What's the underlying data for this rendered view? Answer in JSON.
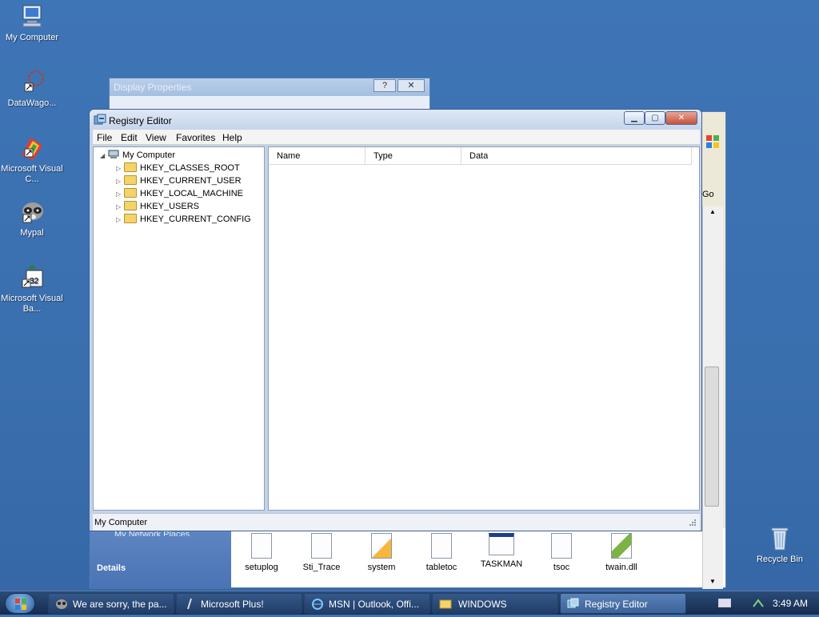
{
  "desktop": {
    "icons": [
      {
        "label": "My Computer"
      },
      {
        "label": "DataWago..."
      },
      {
        "label": "Microsoft Visual C..."
      },
      {
        "label": "Mypal"
      },
      {
        "label": "Microsoft Visual Ba..."
      },
      {
        "label": "Recycle Bin"
      }
    ]
  },
  "display_properties": {
    "title": "Display Properties",
    "help_glyph": "?",
    "close_glyph": "✕"
  },
  "explorer": {
    "go_label": "Go",
    "network_places": "My Network Places",
    "details_label": "Details",
    "files": [
      {
        "name": "setuplog"
      },
      {
        "name": "Sti_Trace"
      },
      {
        "name": "system"
      },
      {
        "name": "tabletoc"
      },
      {
        "name": "TASKMAN"
      },
      {
        "name": "tsoc"
      },
      {
        "name": "twain.dll"
      }
    ]
  },
  "registry": {
    "title": "Registry Editor",
    "menu": [
      "File",
      "Edit",
      "View",
      "Favorites",
      "Help"
    ],
    "tree_root": "My Computer",
    "tree_keys": [
      "HKEY_CLASSES_ROOT",
      "HKEY_CURRENT_USER",
      "HKEY_LOCAL_MACHINE",
      "HKEY_USERS",
      "HKEY_CURRENT_CONFIG"
    ],
    "columns": [
      "Name",
      "Type",
      "Data"
    ],
    "status": "My Computer"
  },
  "taskbar": {
    "buttons": [
      {
        "label": "We are sorry, the pa...",
        "active": false
      },
      {
        "label": "Microsoft Plus!",
        "active": false
      },
      {
        "label": "MSN | Outlook, Offi...",
        "active": false
      },
      {
        "label": "WINDOWS",
        "active": false
      },
      {
        "label": "Registry Editor",
        "active": true
      }
    ],
    "clock": "3:49 AM"
  }
}
